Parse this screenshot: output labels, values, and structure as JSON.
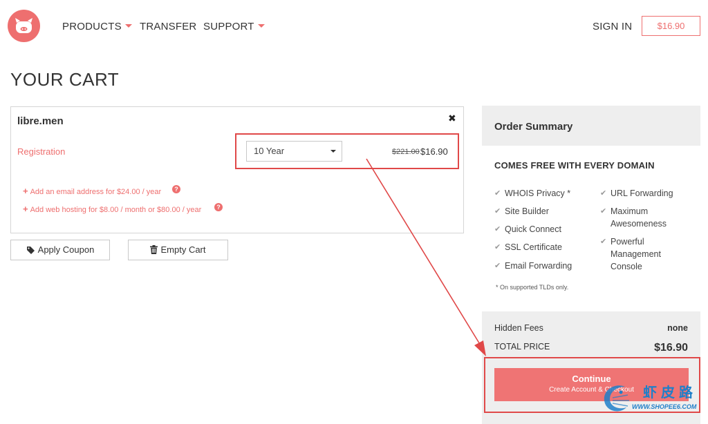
{
  "colors": {
    "accent": "#ee6f6f",
    "annotation": "#e04848",
    "watermark": "#1f7fc9"
  },
  "header": {
    "logo_icon": "pig-logo-icon",
    "nav": [
      {
        "label": "PRODUCTS",
        "has_dropdown": true
      },
      {
        "label": "TRANSFER",
        "has_dropdown": false
      },
      {
        "label": "SUPPORT",
        "has_dropdown": true
      }
    ],
    "sign_in": "SIGN IN",
    "cart_total": "$16.90"
  },
  "page_title": "YOUR CART",
  "cart_item": {
    "domain": "libre.men",
    "remove_icon": "close-icon",
    "registration_label": "Registration",
    "term_selected": "10 Year",
    "old_price": "$221.00",
    "new_price": "$16.90",
    "addons": [
      {
        "text": "Add an email address for $24.00 / year",
        "icon": "help-icon"
      },
      {
        "text": "Add web hosting for $8.00 / month or $80.00 / year",
        "icon": "help-icon"
      }
    ]
  },
  "actions": {
    "apply_coupon": "Apply Coupon",
    "apply_coupon_icon": "tag-icon",
    "empty_cart": "Empty Cart",
    "empty_cart_icon": "trash-icon"
  },
  "summary": {
    "title": "Order Summary",
    "free_heading": "COMES FREE WITH EVERY DOMAIN",
    "features_left": [
      "WHOIS Privacy *",
      "Site Builder",
      "Quick Connect",
      "SSL Certificate",
      "Email Forwarding"
    ],
    "features_right": [
      "URL Forwarding",
      "Maximum Awesomeness",
      "Powerful Management Console"
    ],
    "footnote": "* On supported TLDs only.",
    "hidden_fees_label": "Hidden Fees",
    "hidden_fees_value": "none",
    "total_label": "TOTAL PRICE",
    "total_value": "$16.90",
    "continue_label": "Continue",
    "continue_sub": "Create Account & Checkout"
  },
  "watermark": {
    "chinese": "虾皮路",
    "url": "WWW.SHOPEE6.COM"
  }
}
